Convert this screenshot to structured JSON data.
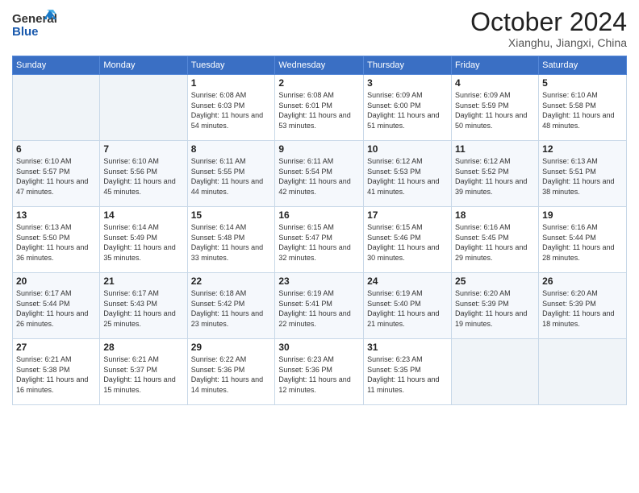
{
  "header": {
    "logo_general": "General",
    "logo_blue": "Blue",
    "month": "October 2024",
    "location": "Xianghu, Jiangxi, China"
  },
  "weekdays": [
    "Sunday",
    "Monday",
    "Tuesday",
    "Wednesday",
    "Thursday",
    "Friday",
    "Saturday"
  ],
  "weeks": [
    [
      {
        "day": "",
        "info": ""
      },
      {
        "day": "",
        "info": ""
      },
      {
        "day": "1",
        "info": "Sunrise: 6:08 AM\nSunset: 6:03 PM\nDaylight: 11 hours and 54 minutes."
      },
      {
        "day": "2",
        "info": "Sunrise: 6:08 AM\nSunset: 6:01 PM\nDaylight: 11 hours and 53 minutes."
      },
      {
        "day": "3",
        "info": "Sunrise: 6:09 AM\nSunset: 6:00 PM\nDaylight: 11 hours and 51 minutes."
      },
      {
        "day": "4",
        "info": "Sunrise: 6:09 AM\nSunset: 5:59 PM\nDaylight: 11 hours and 50 minutes."
      },
      {
        "day": "5",
        "info": "Sunrise: 6:10 AM\nSunset: 5:58 PM\nDaylight: 11 hours and 48 minutes."
      }
    ],
    [
      {
        "day": "6",
        "info": "Sunrise: 6:10 AM\nSunset: 5:57 PM\nDaylight: 11 hours and 47 minutes."
      },
      {
        "day": "7",
        "info": "Sunrise: 6:10 AM\nSunset: 5:56 PM\nDaylight: 11 hours and 45 minutes."
      },
      {
        "day": "8",
        "info": "Sunrise: 6:11 AM\nSunset: 5:55 PM\nDaylight: 11 hours and 44 minutes."
      },
      {
        "day": "9",
        "info": "Sunrise: 6:11 AM\nSunset: 5:54 PM\nDaylight: 11 hours and 42 minutes."
      },
      {
        "day": "10",
        "info": "Sunrise: 6:12 AM\nSunset: 5:53 PM\nDaylight: 11 hours and 41 minutes."
      },
      {
        "day": "11",
        "info": "Sunrise: 6:12 AM\nSunset: 5:52 PM\nDaylight: 11 hours and 39 minutes."
      },
      {
        "day": "12",
        "info": "Sunrise: 6:13 AM\nSunset: 5:51 PM\nDaylight: 11 hours and 38 minutes."
      }
    ],
    [
      {
        "day": "13",
        "info": "Sunrise: 6:13 AM\nSunset: 5:50 PM\nDaylight: 11 hours and 36 minutes."
      },
      {
        "day": "14",
        "info": "Sunrise: 6:14 AM\nSunset: 5:49 PM\nDaylight: 11 hours and 35 minutes."
      },
      {
        "day": "15",
        "info": "Sunrise: 6:14 AM\nSunset: 5:48 PM\nDaylight: 11 hours and 33 minutes."
      },
      {
        "day": "16",
        "info": "Sunrise: 6:15 AM\nSunset: 5:47 PM\nDaylight: 11 hours and 32 minutes."
      },
      {
        "day": "17",
        "info": "Sunrise: 6:15 AM\nSunset: 5:46 PM\nDaylight: 11 hours and 30 minutes."
      },
      {
        "day": "18",
        "info": "Sunrise: 6:16 AM\nSunset: 5:45 PM\nDaylight: 11 hours and 29 minutes."
      },
      {
        "day": "19",
        "info": "Sunrise: 6:16 AM\nSunset: 5:44 PM\nDaylight: 11 hours and 28 minutes."
      }
    ],
    [
      {
        "day": "20",
        "info": "Sunrise: 6:17 AM\nSunset: 5:44 PM\nDaylight: 11 hours and 26 minutes."
      },
      {
        "day": "21",
        "info": "Sunrise: 6:17 AM\nSunset: 5:43 PM\nDaylight: 11 hours and 25 minutes."
      },
      {
        "day": "22",
        "info": "Sunrise: 6:18 AM\nSunset: 5:42 PM\nDaylight: 11 hours and 23 minutes."
      },
      {
        "day": "23",
        "info": "Sunrise: 6:19 AM\nSunset: 5:41 PM\nDaylight: 11 hours and 22 minutes."
      },
      {
        "day": "24",
        "info": "Sunrise: 6:19 AM\nSunset: 5:40 PM\nDaylight: 11 hours and 21 minutes."
      },
      {
        "day": "25",
        "info": "Sunrise: 6:20 AM\nSunset: 5:39 PM\nDaylight: 11 hours and 19 minutes."
      },
      {
        "day": "26",
        "info": "Sunrise: 6:20 AM\nSunset: 5:39 PM\nDaylight: 11 hours and 18 minutes."
      }
    ],
    [
      {
        "day": "27",
        "info": "Sunrise: 6:21 AM\nSunset: 5:38 PM\nDaylight: 11 hours and 16 minutes."
      },
      {
        "day": "28",
        "info": "Sunrise: 6:21 AM\nSunset: 5:37 PM\nDaylight: 11 hours and 15 minutes."
      },
      {
        "day": "29",
        "info": "Sunrise: 6:22 AM\nSunset: 5:36 PM\nDaylight: 11 hours and 14 minutes."
      },
      {
        "day": "30",
        "info": "Sunrise: 6:23 AM\nSunset: 5:36 PM\nDaylight: 11 hours and 12 minutes."
      },
      {
        "day": "31",
        "info": "Sunrise: 6:23 AM\nSunset: 5:35 PM\nDaylight: 11 hours and 11 minutes."
      },
      {
        "day": "",
        "info": ""
      },
      {
        "day": "",
        "info": ""
      }
    ]
  ]
}
